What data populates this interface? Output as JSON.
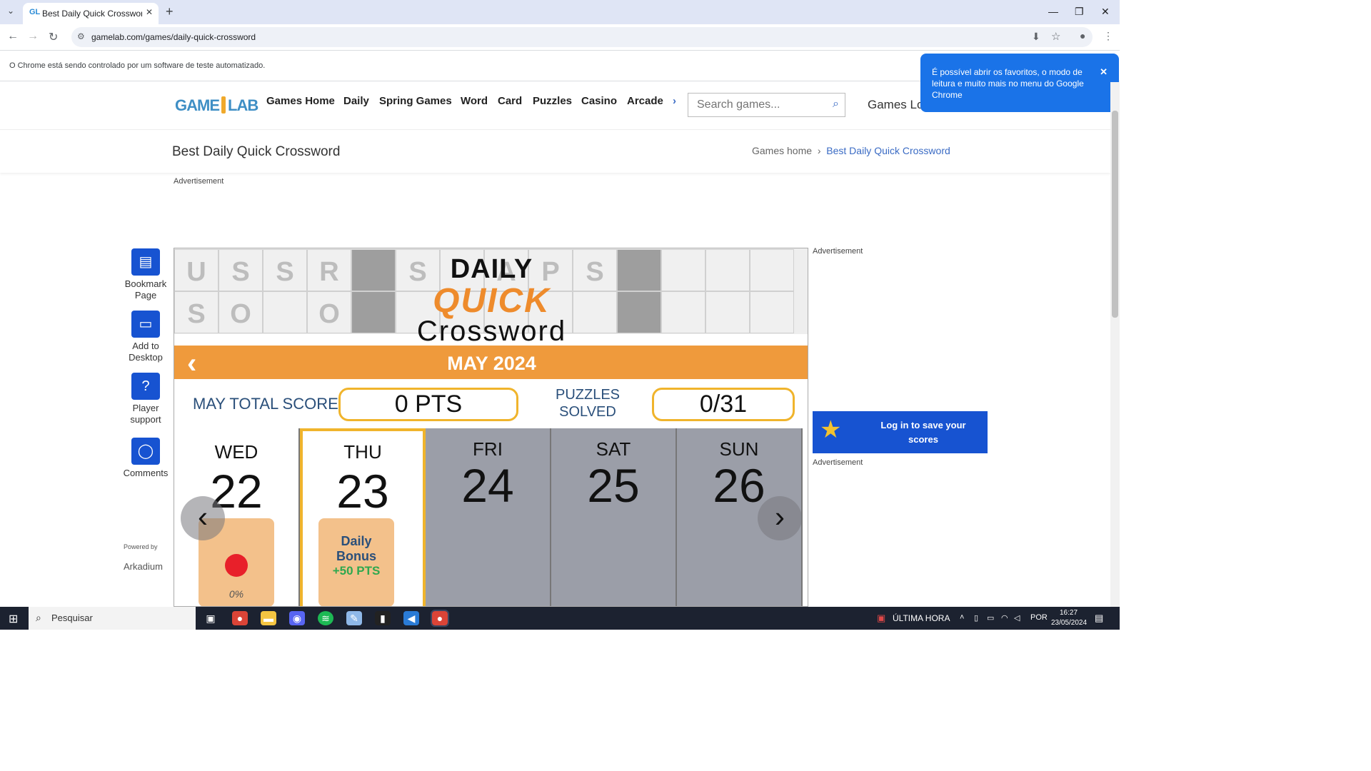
{
  "browser": {
    "tab_title": "Best Daily Quick Crossword - Fr",
    "tab_favicon": "GL",
    "url": "gamelab.com/games/daily-quick-crossword",
    "infobar_text": "O Chrome está sendo controlado por um software de teste automatizado.",
    "popup_text": "É possível abrir os favoritos, o modo de leitura e muito mais no menu do Google Chrome"
  },
  "site": {
    "logo_left": "GAME",
    "logo_right": "LAB",
    "nav": [
      "Games Home",
      "Daily",
      "Spring Games",
      "Word",
      "Card",
      "Puzzles",
      "Casino",
      "Arcade"
    ],
    "search_placeholder": "Search games...",
    "login_link": "Games Lo",
    "page_title": "Best Daily Quick Crossword",
    "breadcrumb": {
      "home": "Games home",
      "current": "Best Daily Quick Crossword"
    },
    "ad_label": "Advertisement"
  },
  "rail": [
    {
      "label1": "Bookmark",
      "label2": "Page",
      "icon": "bookmark-icon"
    },
    {
      "label1": "Add to",
      "label2": "Desktop",
      "icon": "desktop-icon"
    },
    {
      "label1": "Player",
      "label2": "support",
      "icon": "help-icon"
    },
    {
      "label1": "Comments",
      "label2": "",
      "icon": "comment-icon"
    }
  ],
  "powered_by": "Powered by",
  "powered_brand": "Arkadium",
  "game": {
    "logo_daily": "DAILY",
    "logo_quick": "QUICK",
    "logo_crossword": "Crossword",
    "month": "MAY 2024",
    "total_label": "MAY TOTAL SCORE",
    "total_value": "0 PTS",
    "solved_label": "PUZZLES SOLVED",
    "solved_value": "0/31",
    "days": [
      {
        "dow": "WED",
        "num": "22",
        "state": "past",
        "progress": "0%"
      },
      {
        "dow": "THU",
        "num": "23",
        "state": "today",
        "bonus_label": "Daily Bonus",
        "bonus_pts": "+50 PTS"
      },
      {
        "dow": "FRI",
        "num": "24",
        "state": "future"
      },
      {
        "dow": "SAT",
        "num": "25",
        "state": "future"
      },
      {
        "dow": "SUN",
        "num": "26",
        "state": "future"
      }
    ],
    "grid_row1": [
      "U",
      "S",
      "S",
      "R",
      "",
      "S",
      "",
      "A",
      "P",
      "S",
      "",
      "",
      "",
      ""
    ],
    "grid_row2": [
      "S",
      "O",
      "",
      "O",
      "",
      "",
      "",
      "",
      "",
      "",
      "",
      "",
      "",
      ""
    ]
  },
  "promo": {
    "text": "Log in to save your scores"
  },
  "taskbar": {
    "search": "Pesquisar",
    "news": "ÚLTIMA HORA",
    "lang": "POR",
    "time": "16:27",
    "date": "23/05/2024"
  }
}
